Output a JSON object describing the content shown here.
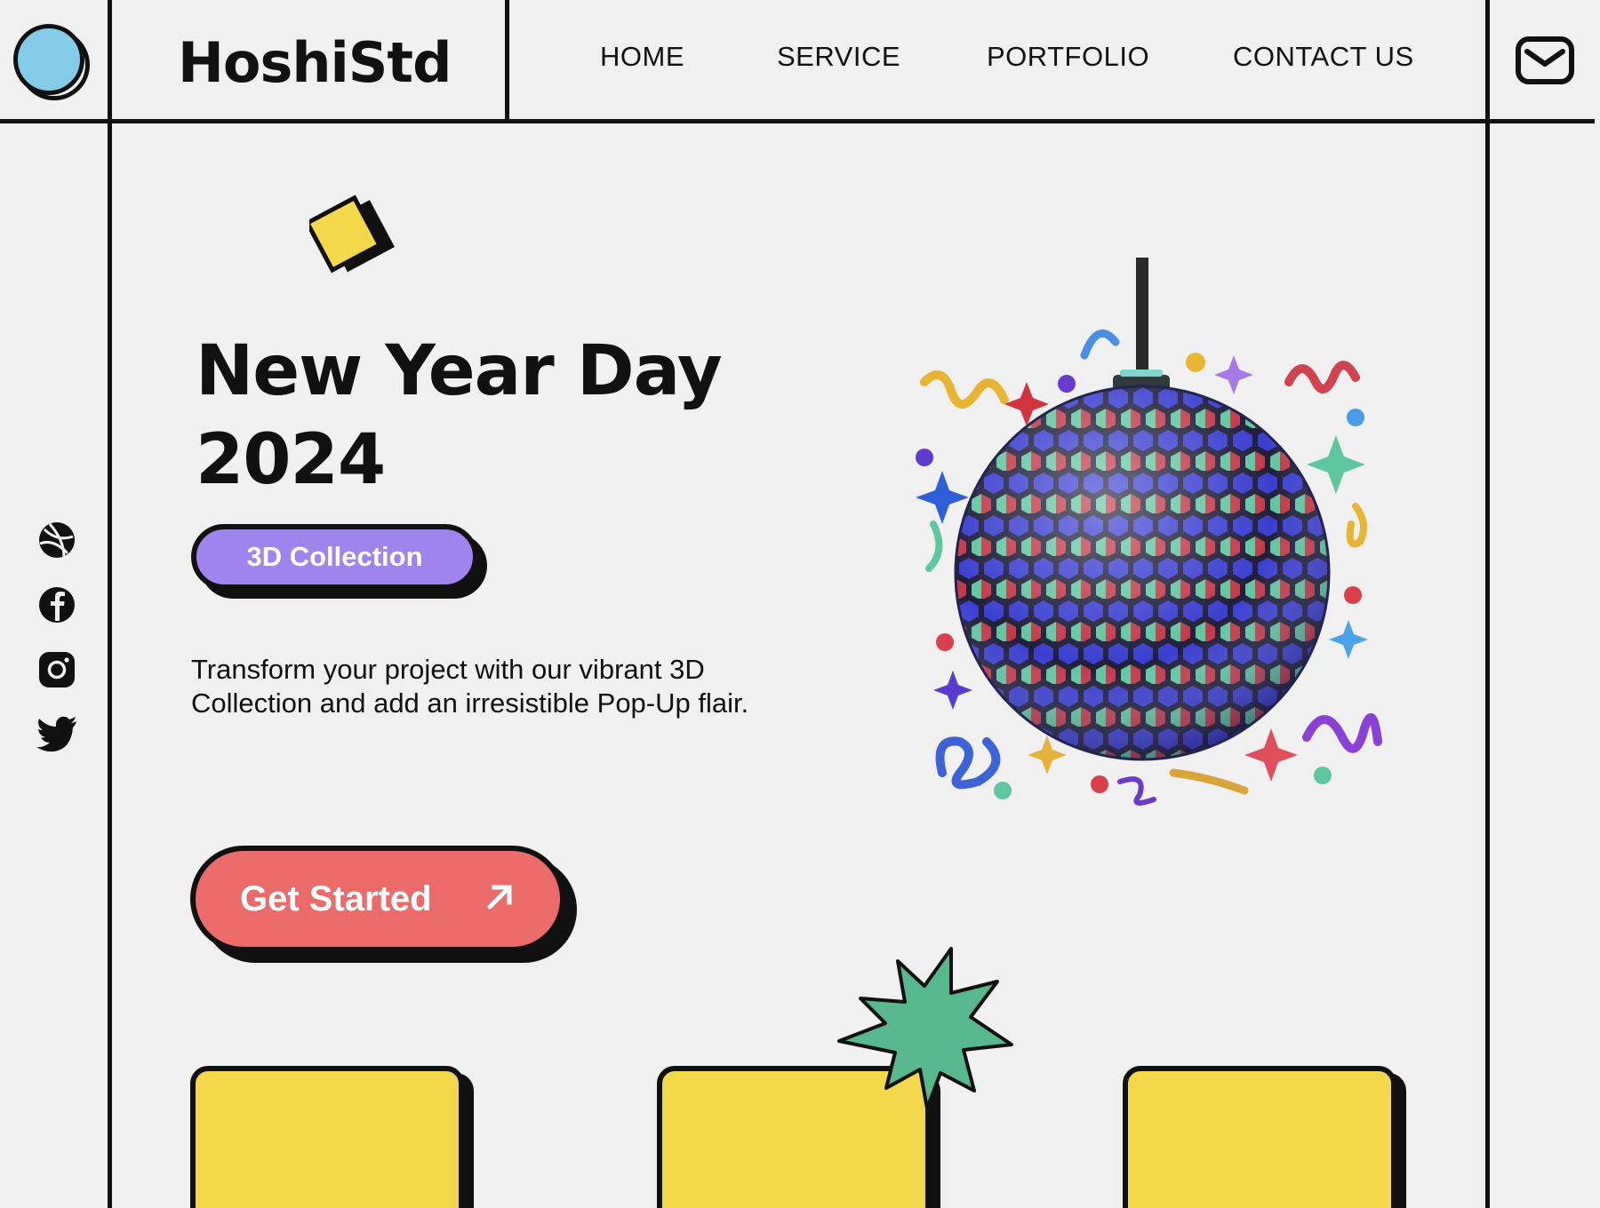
{
  "brand": {
    "name": "HoshiStd"
  },
  "nav": {
    "items": [
      {
        "label": "HOME"
      },
      {
        "label": "SERVICE"
      },
      {
        "label": "PORTFOLIO"
      },
      {
        "label": "CONTACT US"
      }
    ]
  },
  "header": {
    "mail_icon": "mail-icon"
  },
  "social": [
    "dribbble-icon",
    "facebook-icon",
    "instagram-icon",
    "twitter-icon"
  ],
  "hero": {
    "title_line1": "New Year Day",
    "title_line2": "2024",
    "tag": "3D Collection",
    "description": "Transform your project with our vibrant 3D Collection and add an irresistible Pop-Up flair.",
    "cta_label": "Get Started",
    "cta_icon": "arrow-up-right-icon"
  },
  "colors": {
    "background": "#f0f0f0",
    "ink": "#111111",
    "logo_blue": "#84cbe8",
    "tag_purple": "#9f84ee",
    "cta_red": "#eb6b6b",
    "card_yellow": "#f3d84b",
    "burst_green": "#57b88e"
  }
}
